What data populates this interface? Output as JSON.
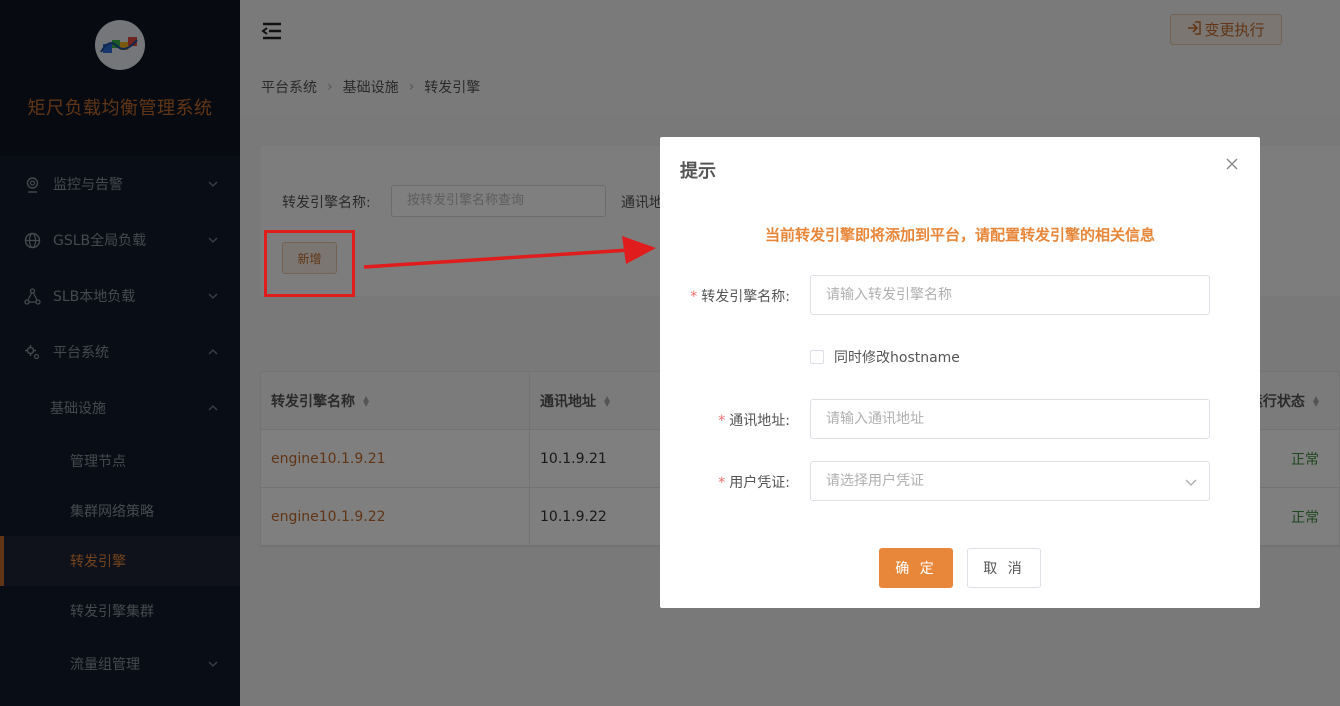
{
  "app": {
    "title": "矩尺负载均衡管理系统"
  },
  "sidebar": {
    "items": [
      {
        "label": "监控与告警",
        "icon": "monitor-icon",
        "expanded": false
      },
      {
        "label": "GSLB全局负载",
        "icon": "globe-icon",
        "expanded": false
      },
      {
        "label": "SLB本地负载",
        "icon": "network-icon",
        "expanded": false
      },
      {
        "label": "平台系统",
        "icon": "gear-icon",
        "expanded": true
      }
    ],
    "subgroup": {
      "label": "基础设施",
      "expanded": true
    },
    "subitems": [
      {
        "label": "管理节点",
        "active": false
      },
      {
        "label": "集群网络策略",
        "active": false
      },
      {
        "label": "转发引擎",
        "active": true
      },
      {
        "label": "转发引擎集群",
        "active": false
      }
    ],
    "traffic_group": {
      "label": "流量组管理"
    }
  },
  "header": {
    "exec_label": "变更执行"
  },
  "breadcrumb": [
    "平台系统",
    "基础设施",
    "转发引擎"
  ],
  "search": {
    "engine_label": "转发引擎名称:",
    "engine_placeholder": "按转发引擎名称查询",
    "addr_label": "通讯地址"
  },
  "add_button": "新增",
  "table": {
    "headers": [
      "转发引擎名称",
      "通讯地址",
      "运行状态"
    ],
    "rows": [
      {
        "name": "engine10.1.9.21",
        "address": "10.1.9.21",
        "status": "正常"
      },
      {
        "name": "engine10.1.9.22",
        "address": "10.1.9.22",
        "status": "正常"
      }
    ]
  },
  "modal": {
    "title": "提示",
    "notice": "当前转发引擎即将添加到平台，请配置转发引擎的相关信息",
    "engine_name_label": "转发引擎名称:",
    "engine_name_placeholder": "请输入转发引擎名称",
    "hostname_checkbox": "同时修改hostname",
    "address_label": "通讯地址:",
    "address_placeholder": "请输入通讯地址",
    "credential_label": "用户凭证:",
    "credential_placeholder": "请选择用户凭证",
    "confirm": "确 定",
    "cancel": "取 消"
  },
  "colors": {
    "accent": "#e8873a",
    "brand": "#c36b2c",
    "sidebar_bg": "#131b2b",
    "annotation_red": "#e01c1c"
  }
}
